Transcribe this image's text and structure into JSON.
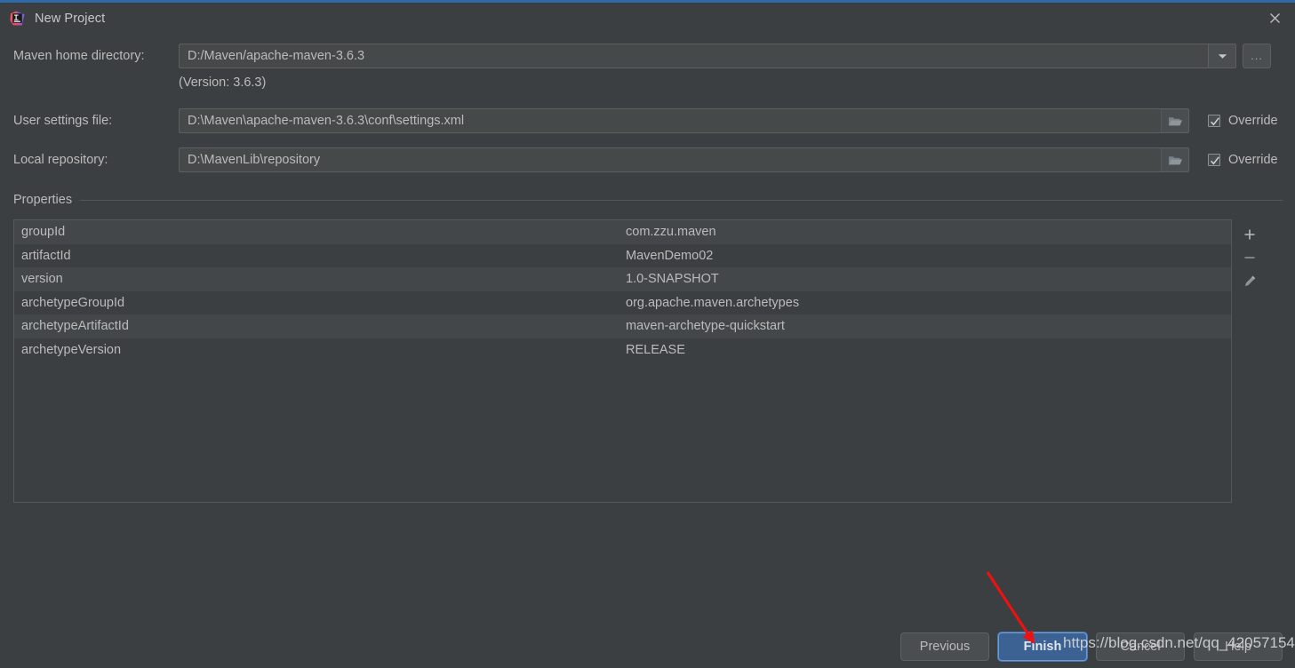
{
  "window": {
    "title": "New Project",
    "app_icon": "intellij-idea-logo",
    "close_icon": "close-icon",
    "accent_color": "#2f6aa8",
    "background_color": "#3c3f41"
  },
  "form": {
    "maven_home": {
      "label": "Maven home directory:",
      "value": "D:/Maven/apache-maven-3.6.3",
      "dropdown_icon": "chevron-down-icon",
      "browse_label": "...",
      "version_note": "(Version: 3.6.3)"
    },
    "user_settings": {
      "label": "User settings file:",
      "value": "D:\\Maven\\apache-maven-3.6.3\\conf\\settings.xml",
      "folder_icon": "folder-icon",
      "override_label": "Override",
      "override_checked": true
    },
    "local_repository": {
      "label": "Local repository:",
      "value": "D:\\MavenLib\\repository",
      "folder_icon": "folder-icon",
      "override_label": "Override",
      "override_checked": true
    }
  },
  "properties": {
    "group_title": "Properties",
    "rows": [
      {
        "key": "groupId",
        "value": "com.zzu.maven"
      },
      {
        "key": "artifactId",
        "value": "MavenDemo02"
      },
      {
        "key": "version",
        "value": "1.0-SNAPSHOT"
      },
      {
        "key": "archetypeGroupId",
        "value": "org.apache.maven.archetypes"
      },
      {
        "key": "archetypeArtifactId",
        "value": "maven-archetype-quickstart"
      },
      {
        "key": "archetypeVersion",
        "value": "RELEASE"
      }
    ],
    "toolbar": {
      "add_icon": "plus-icon",
      "remove_icon": "minus-icon",
      "edit_icon": "pencil-icon"
    }
  },
  "footer": {
    "previous_label": "Previous",
    "finish_label": "Finish",
    "cancel_label": "Cancel",
    "help_label": "Help",
    "default_button_color": "#3c6294"
  },
  "annotations": {
    "arrow_color": "#ee1111",
    "watermark": "https://blog.csdn.net/qq_42057154"
  }
}
